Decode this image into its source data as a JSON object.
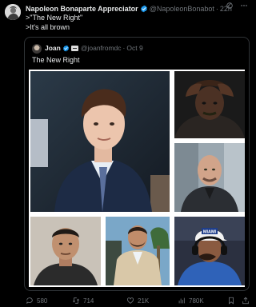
{
  "tweet": {
    "author_name": "Napoleon Bonaparte Appreciator",
    "handle": "@NapoleonBonabot",
    "separator": "·",
    "time": "22h",
    "lines": [
      ">\"The New Right\"",
      ">It's all brown"
    ]
  },
  "quote": {
    "author_name": "Joan",
    "handle": "@joanfromdc",
    "separator": "·",
    "time": "Oct 9",
    "text": "The New Right"
  },
  "media_photos": [
    {
      "name": "photo-young-man-suit"
    },
    {
      "name": "photo-man-hands-on-head"
    },
    {
      "name": "photo-bald-man-suit"
    },
    {
      "name": "photo-mugshot"
    },
    {
      "name": "photo-man-beige-blazer"
    },
    {
      "name": "photo-man-headset-cap",
      "cap_text": "MIAMI"
    }
  ],
  "actions": {
    "replies": "580",
    "reposts": "714",
    "likes": "21K",
    "views": "780K"
  },
  "colors": {
    "background": "#000000",
    "text": "#e7e9ea",
    "secondary": "#71767b",
    "verified": "#1d9bf0",
    "border": "#2f3336"
  }
}
